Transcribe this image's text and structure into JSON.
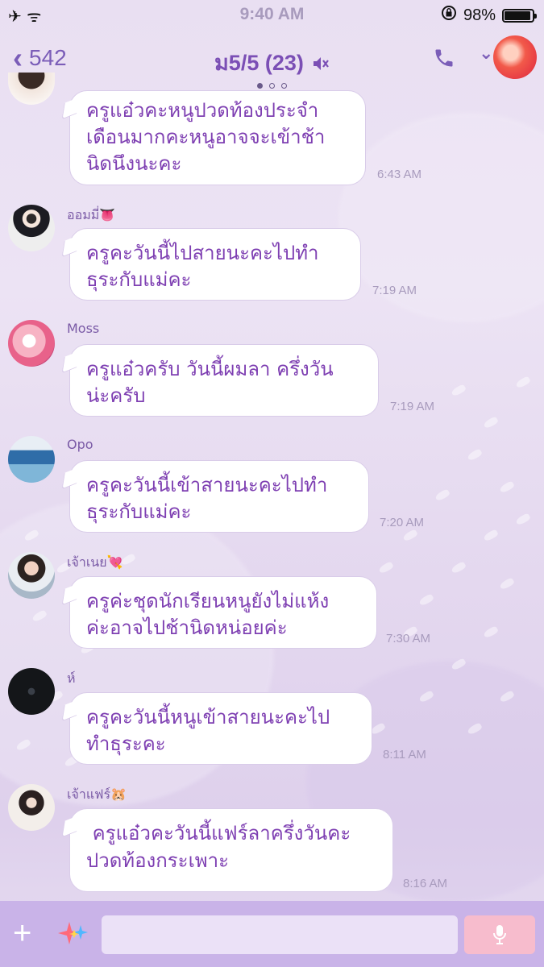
{
  "status_bar": {
    "left": "✈ ᯤ",
    "time": "9:40 AM",
    "battery": "98%",
    "battery_level": 0.98,
    "rotation_lock_icon": "rotation-lock-icon"
  },
  "header": {
    "back_count": "542",
    "title": "ม5/5 (23)",
    "page_dots": 3,
    "active_dot": 0,
    "icons": [
      "chevron-left-icon",
      "mute-icon",
      "phone-icon",
      "chevron-down-icon"
    ]
  },
  "messages": [
    {
      "sender": "",
      "text": "ครูแอ๋วคะหนูปวดท้องประจำ\nเดือนมากคะหนูอาจจะเข้าช้า\nนิดนึงนะคะ",
      "time": "6:43 AM"
    },
    {
      "sender": "ออมมี่👅",
      "text": "ครูคะวันนี้ไปสายนะคะไปทำ\nธุระกับแม่คะ",
      "time": "7:19 AM"
    },
    {
      "sender": "Moss",
      "text": "ครูแอ๋วครับ วันนี้ผมลา ครึ่งวัน\nน่ะครับ",
      "time": "7:19 AM"
    },
    {
      "sender": "Opo",
      "text": "ครูคะวันนี้เข้าสายนะคะไปทำ\nธุระกับแม่คะ",
      "time": "7:20 AM"
    },
    {
      "sender": "เจ้าเนย💘",
      "text": "ครูค่ะชุดนักเรียนหนูยังไม่แห้ง\nค่ะอาจไปช้านิดหน่อยค่ะ",
      "time": "7:30 AM"
    },
    {
      "sender": "ห์",
      "text": "ครูคะวันนี้หนูเข้าสายนะคะไป\nทำธุระคะ",
      "time": "8:11 AM"
    },
    {
      "sender": "เจ้าแฟร์🐹",
      "text": " ครูแอ๋วคะวันนี้แฟร์ลาครึ่งวันคะ\nปวดท้องกระเพาะ",
      "time": "8:16 AM"
    }
  ],
  "input_bar": {
    "placeholder": "",
    "icons": [
      "plus-icon",
      "sparkle-icon",
      "microphone-icon"
    ]
  },
  "colors": {
    "accent": "#7b4fb5",
    "bubble_text": "#7e3fb2",
    "input_bar": "#c9b3e8",
    "mic_button": "#f7bccd"
  }
}
